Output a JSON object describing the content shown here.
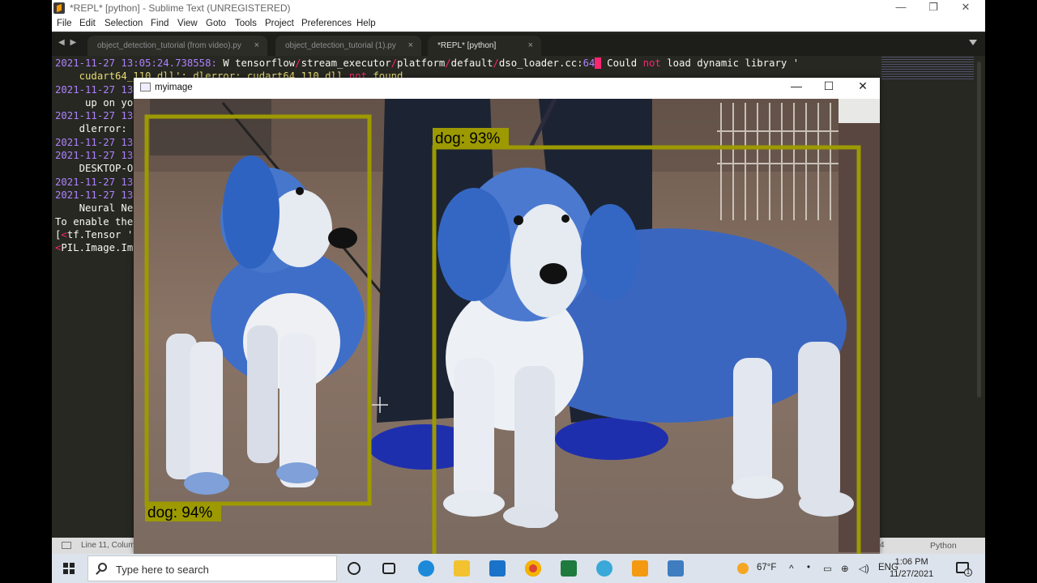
{
  "window": {
    "title": "*REPL* [python] - Sublime Text (UNREGISTERED)",
    "minimize_glyph": "—",
    "restore_glyph": "❐",
    "close_glyph": "✕"
  },
  "menu": [
    "File",
    "Edit",
    "Selection",
    "Find",
    "View",
    "Goto",
    "Tools",
    "Project",
    "Preferences",
    "Help"
  ],
  "tab_nav_glyph": "◀ ▶",
  "tabs": [
    {
      "label": "object_detection_tutorial (from video).py",
      "close": "×"
    },
    {
      "label": "object_detection_tutorial (1).py",
      "close": "×"
    },
    {
      "label": "*REPL* [python]",
      "close": "×"
    }
  ],
  "editor": {
    "line1": {
      "timestamp": "2021-11-27 13:05:24.738558:",
      "level": " W ",
      "p1": "tensorflow",
      "p2": "stream_executor",
      "p3": "platform",
      "p4": "default",
      "file": "dso_loader.cc:",
      "lineno": "64",
      "msg_a": " Could ",
      "not": "not",
      "msg_b": " load dynamic library '"
    },
    "line2_text": "    cudart64_110.dll'; dlerror: cudart64_110.dll ",
    "line2_not": "not",
    "line2_end": " found",
    "ts_short": "2021-11-27 13",
    "line4": "     up on yo",
    "line6": "    dlerror: ",
    "line9": "    DESKTOP-O",
    "line12": "    Neural Ne",
    "line13": "To enable the",
    "line14_pre": "[",
    "line14_lt": "<",
    "line14": "tf.Tensor '",
    "line15_lt": "<",
    "line15": "PIL.Image.Im"
  },
  "image_window": {
    "title": "myimage",
    "minimize_glyph": "—",
    "maximize_glyph": "☐",
    "close_glyph": "✕"
  },
  "detections": [
    {
      "label": "dog: 94%",
      "box": "small dog",
      "color": "#9c9a00"
    },
    {
      "label": "dog: 93%",
      "box": "large dog",
      "color": "#9c9a00"
    }
  ],
  "statusbar": {
    "position": "Line 11, Colum",
    "tab_size": "4",
    "syntax": "Python"
  },
  "taskbar": {
    "search_placeholder": "Type here to search",
    "weather": "67°F",
    "language": "ENG",
    "time": "1:06 PM",
    "date": "11/27/2021",
    "notifications": "1"
  }
}
